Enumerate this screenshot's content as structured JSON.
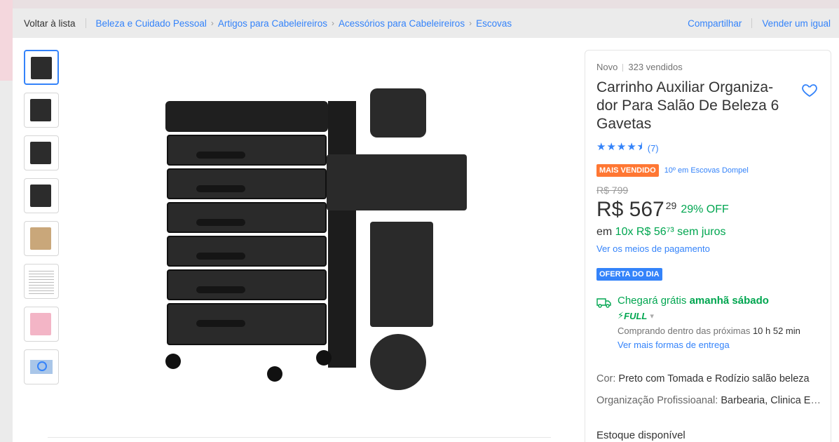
{
  "breadcrumb": {
    "back": "Voltar à lista",
    "items": [
      "Beleza e Cuidado Pessoal",
      "Artigos para Cabeleireiros",
      "Acessórios para Cabeleireiros",
      "Escovas"
    ],
    "share": "Compartilhar",
    "sell": "Vender um igual"
  },
  "product": {
    "condition": "Novo",
    "sold": "323 vendidos",
    "title": "Carrinho Auxiliar Organiza-dor Para Salão De Beleza 6 Gavetas",
    "stars": "★★★★⯨",
    "rating_value": 4.5,
    "reviews": "(7)",
    "best_seller": "MAIS VENDIDO",
    "ranking": "10º em Escovas Dompel",
    "old_price": "R$ 799",
    "price_main": "R$ 567",
    "price_cents": "29",
    "discount": "29% OFF",
    "installments_prefix": "em ",
    "installments": "10x R$ 56⁷³ sem juros",
    "payment_link": "Ver os meios de pagamento",
    "deal_badge": "OFERTA DO DIA",
    "shipping_prefix": "Chegará grátis ",
    "shipping_day": "amanhã sábado",
    "full": "FULL",
    "within_prefix": "Comprando dentro das próximas ",
    "within_time": "10 h 52 min",
    "more_delivery": "Ver mais formas de entrega",
    "attr1_label": "Cor: ",
    "attr1_value": "Preto com Tomada e Rodízio salão beleza",
    "attr2_label": "Organização Profissioanal: ",
    "attr2_value": "Barbearia, Clinica Estética",
    "stock": "Estoque disponível"
  },
  "colors": {
    "accent": "#3483fa",
    "green": "#00a650",
    "orange": "#ff7733"
  }
}
